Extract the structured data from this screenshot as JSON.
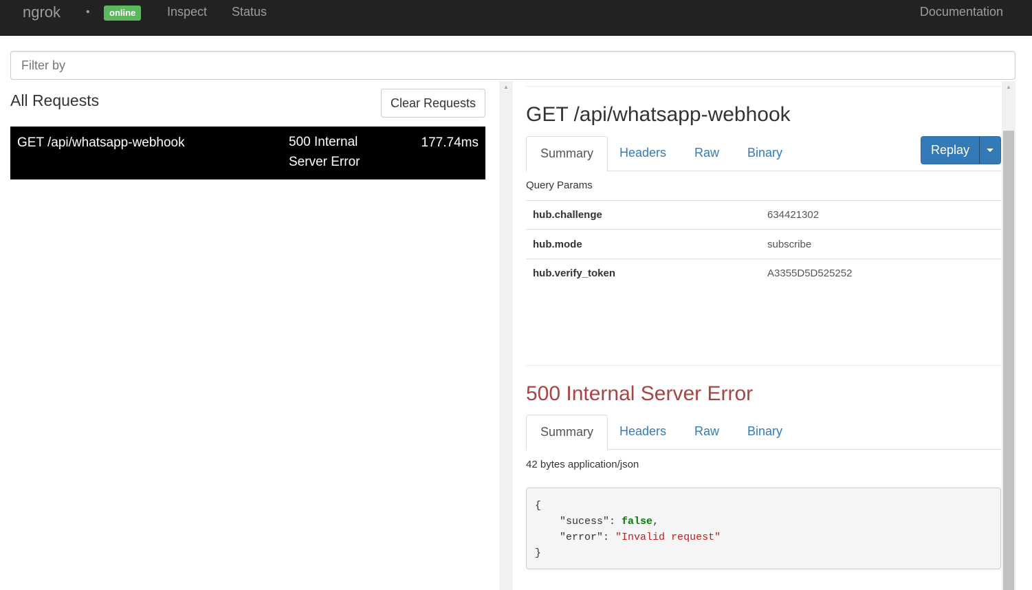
{
  "navbar": {
    "brand": "ngrok",
    "separator": "•",
    "status_badge": "online",
    "links": {
      "inspect": "Inspect",
      "status": "Status",
      "documentation": "Documentation"
    }
  },
  "filter": {
    "placeholder": "Filter by",
    "value": ""
  },
  "requests": {
    "title": "All Requests",
    "clear_label": "Clear Requests",
    "items": [
      {
        "path": "GET /api/whatsapp-webhook",
        "status": "500 Internal Server Error",
        "duration": "177.74ms"
      }
    ]
  },
  "detail": {
    "request": {
      "title": "GET /api/whatsapp-webhook",
      "tabs": [
        "Summary",
        "Headers",
        "Raw",
        "Binary"
      ],
      "replay_label": "Replay",
      "section_label": "Query Params",
      "params": [
        {
          "key": "hub.challenge",
          "value": "634421302"
        },
        {
          "key": "hub.mode",
          "value": "subscribe"
        },
        {
          "key": "hub.verify_token",
          "value": "A3355D5D525252"
        }
      ]
    },
    "response": {
      "title": "500 Internal Server Error",
      "tabs": [
        "Summary",
        "Headers",
        "Raw",
        "Binary"
      ],
      "meta": "42 bytes application/json",
      "body": {
        "open": "{",
        "line1_key": "\"sucess\"",
        "line1_sep": ": ",
        "line1_val": "false",
        "line1_end": ",",
        "line2_key": "\"error\"",
        "line2_sep": ": ",
        "line2_val": "\"Invalid request\"",
        "close": "}"
      }
    }
  },
  "colors": {
    "navbar_bg": "#222222",
    "online_badge": "#5cb85c",
    "primary": "#337ab7",
    "error_title": "#a94442",
    "selected_row_bg": "#000000"
  }
}
